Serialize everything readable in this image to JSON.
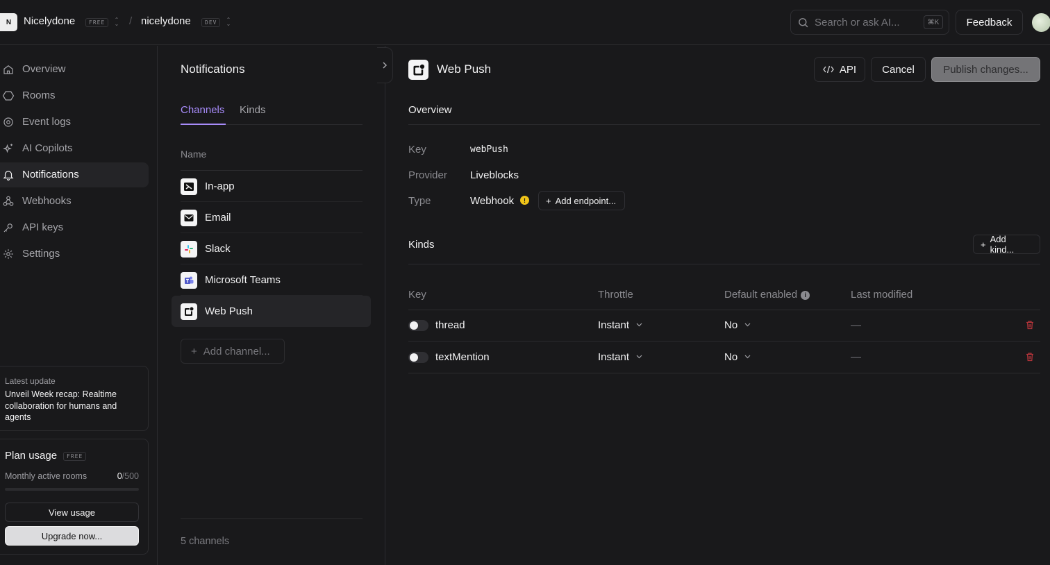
{
  "topbar": {
    "logo_letter": "N",
    "workspace": "Nicelydone",
    "workspace_plan": "FREE",
    "separator": "/",
    "project": "nicelydone",
    "project_env": "DEV",
    "search_placeholder": "Search or ask AI...",
    "search_shortcut": "⌘K",
    "feedback_label": "Feedback"
  },
  "sidebar": {
    "items": [
      {
        "label": "Overview",
        "icon": "home-icon"
      },
      {
        "label": "Rooms",
        "icon": "hexagon-icon"
      },
      {
        "label": "Event logs",
        "icon": "target-icon"
      },
      {
        "label": "AI Copilots",
        "icon": "sparkle-icon"
      },
      {
        "label": "Notifications",
        "icon": "bell-icon",
        "active": true
      },
      {
        "label": "Webhooks",
        "icon": "webhook-icon"
      },
      {
        "label": "API keys",
        "icon": "key-icon"
      },
      {
        "label": "Settings",
        "icon": "gear-icon"
      }
    ],
    "update": {
      "kicker": "Latest update",
      "text": "Unveil Week recap: Realtime collaboration for humans and agents"
    },
    "plan": {
      "title": "Plan usage",
      "tag": "FREE",
      "metric_label": "Monthly active rooms",
      "used": "0",
      "max": "/500",
      "usage_fraction": 0,
      "view_usage_label": "View usage",
      "upgrade_label": "Upgrade now..."
    }
  },
  "channels_panel": {
    "title": "Notifications",
    "tabs": [
      {
        "label": "Channels",
        "active": true
      },
      {
        "label": "Kinds",
        "active": false
      }
    ],
    "column_header": "Name",
    "channels": [
      {
        "label": "In-app",
        "icon": "in-app-icon"
      },
      {
        "label": "Email",
        "icon": "email-icon"
      },
      {
        "label": "Slack",
        "icon": "slack-icon"
      },
      {
        "label": "Microsoft Teams",
        "icon": "teams-icon"
      },
      {
        "label": "Web Push",
        "icon": "web-push-icon",
        "active": true
      }
    ],
    "add_channel_label": "Add channel...",
    "count_label": "5 channels"
  },
  "detail": {
    "title": "Web Push",
    "api_label": "API",
    "cancel_label": "Cancel",
    "publish_label": "Publish changes...",
    "overview": {
      "title": "Overview",
      "key_label": "Key",
      "key_value": "webPush",
      "provider_label": "Provider",
      "provider_value": "Liveblocks",
      "type_label": "Type",
      "type_value": "Webhook",
      "warning_mark": "!",
      "add_endpoint_label": "Add endpoint..."
    },
    "kinds": {
      "title": "Kinds",
      "add_kind_label": "Add kind...",
      "columns": [
        "Key",
        "Throttle",
        "Default enabled",
        "Last modified"
      ],
      "info_mark": "i",
      "rows": [
        {
          "key": "thread",
          "throttle": "Instant",
          "default_enabled": "No",
          "last_modified": "—",
          "enabled": false
        },
        {
          "key": "textMention",
          "throttle": "Instant",
          "default_enabled": "No",
          "last_modified": "—",
          "enabled": false
        }
      ]
    }
  },
  "colors": {
    "background": "#19191b",
    "accent": "#a78bfa",
    "border": "#2c2c2f",
    "warning": "#f0c419",
    "danger": "#b3343a"
  }
}
